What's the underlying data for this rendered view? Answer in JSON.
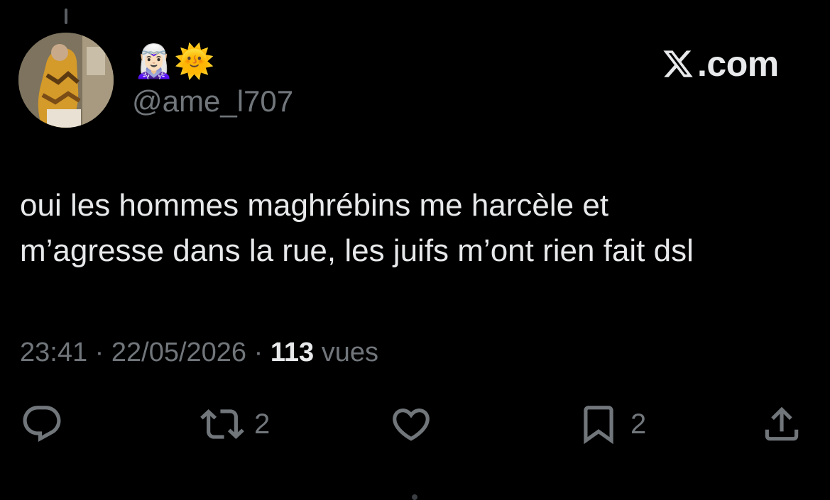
{
  "author": {
    "display_name_emoji": "🧝🏻‍♀️🌞",
    "handle": "@ame_l707",
    "avatar_icon": "profile-photo"
  },
  "brand": {
    "label": ".com",
    "icon": "x-logo-icon"
  },
  "tweet": {
    "text": "oui les hommes maghrébins me harcèle et\nm’agresse dans la rue, les juifs m’ont rien fait dsl"
  },
  "meta": {
    "time": "23:41",
    "separator": " · ",
    "date": "22/05/2026",
    "views_count": "113",
    "views_label": " vues"
  },
  "actions": {
    "reply_icon": "reply-icon",
    "repost_count": "2",
    "like_icon": "heart-icon",
    "bookmark_count": "2",
    "share_icon": "share-icon"
  },
  "colors": {
    "background": "#000000",
    "text": "#e7e9ea",
    "muted": "#71767b"
  }
}
